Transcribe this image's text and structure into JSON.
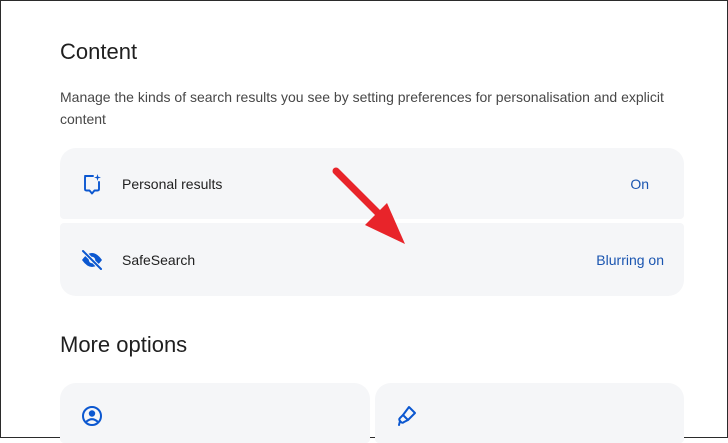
{
  "content_section": {
    "title": "Content",
    "description": "Manage the kinds of search results you see by setting preferences for personalisation and explicit content",
    "rows": [
      {
        "icon": "personal-results-icon",
        "label": "Personal results",
        "value": "On"
      },
      {
        "icon": "eye-off-icon",
        "label": "SafeSearch",
        "value": "Blurring on"
      }
    ]
  },
  "more_options_section": {
    "title": "More options",
    "cards": [
      {
        "icon": "account-circle-icon"
      },
      {
        "icon": "clean-brush-icon"
      }
    ]
  },
  "colors": {
    "accent": "#1a55b0",
    "icon_blue": "#0b57d0",
    "row_background": "#f5f6f8",
    "annotation_arrow": "#e8242a"
  }
}
